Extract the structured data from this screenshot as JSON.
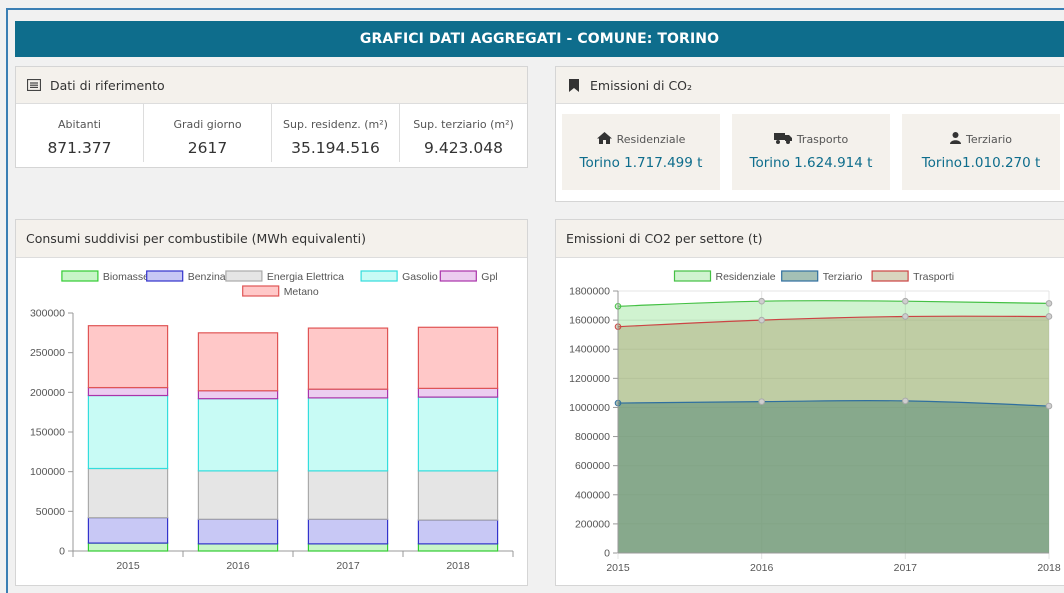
{
  "header": {
    "title": "GRAFICI DATI AGGREGATI - COMUNE: TORINO"
  },
  "reference": {
    "title": "Dati di riferimento",
    "icon": "list-icon",
    "columns": [
      {
        "label": "Abitanti",
        "value": "871.377"
      },
      {
        "label": "Gradi giorno",
        "value": "2617"
      },
      {
        "label": "Sup. residenz. (m²)",
        "value": "35.194.516"
      },
      {
        "label": "Sup. terziario (m²)",
        "value": "9.423.048"
      }
    ]
  },
  "emissions": {
    "title": "Emissioni di CO₂",
    "icon": "bookmark-icon",
    "boxes": [
      {
        "label": "Residenziale",
        "icon": "home-icon",
        "value": "Torino 1.717.499 t"
      },
      {
        "label": "Trasporto",
        "icon": "truck-icon",
        "value": "Torino 1.624.914 t"
      },
      {
        "label": "Terziario",
        "icon": "user-icon",
        "value": "Torino1.010.270 t"
      }
    ]
  },
  "chart_data": [
    {
      "type": "bar",
      "stacked": true,
      "title": "Consumi suddivisi per combustibile (MWh equivalenti)",
      "categories": [
        "2015",
        "2016",
        "2017",
        "2018"
      ],
      "ylim": [
        0,
        300000
      ],
      "yticks": [
        "0",
        "50000",
        "100000",
        "150000",
        "200000",
        "250000",
        "300000"
      ],
      "legend_position": "top",
      "series": [
        {
          "name": "Biomasse",
          "color": "#33cc33",
          "fill": "#c8f5c8",
          "values": [
            10000,
            9000,
            9000,
            9000
          ]
        },
        {
          "name": "Benzina",
          "color": "#3333cc",
          "fill": "#c8c8f5",
          "values": [
            32000,
            31000,
            31000,
            30000
          ]
        },
        {
          "name": "Energia Elettrica",
          "color": "#aaaaaa",
          "fill": "#e5e5e5",
          "values": [
            62000,
            61000,
            61000,
            62000
          ]
        },
        {
          "name": "Gasolio",
          "color": "#33dddd",
          "fill": "#c8fbf5",
          "values": [
            92000,
            91000,
            92000,
            93000
          ]
        },
        {
          "name": "Gpl",
          "color": "#aa33aa",
          "fill": "#eccdf0",
          "values": [
            10000,
            10000,
            11000,
            11000
          ]
        },
        {
          "name": "Metano",
          "color": "#e05555",
          "fill": "#ffc8c8",
          "values": [
            78000,
            73000,
            77000,
            77000
          ]
        }
      ]
    },
    {
      "type": "area",
      "title": "Emissioni di CO2 per settore (t)",
      "x": [
        "2015",
        "2016",
        "2017",
        "2018"
      ],
      "ylim": [
        0,
        1800000
      ],
      "yticks": [
        "0",
        "200000",
        "400000",
        "600000",
        "800000",
        "1000000",
        "1200000",
        "1400000",
        "1600000",
        "1800000"
      ],
      "legend_position": "top",
      "series": [
        {
          "name": "Residenziale",
          "color": "#44c044",
          "fill": "rgba(120,220,120,0.35)",
          "values": [
            1695000,
            1730000,
            1730000,
            1715000
          ]
        },
        {
          "name": "Terziario",
          "color": "#2f6f9f",
          "fill": "rgba(90,140,120,0.55)",
          "values": [
            1030000,
            1040000,
            1045000,
            1010000
          ]
        },
        {
          "name": "Trasporti",
          "color": "#cc4444",
          "fill": "rgba(170,160,110,0.45)",
          "values": [
            1555000,
            1600000,
            1625000,
            1625000
          ]
        }
      ]
    }
  ]
}
